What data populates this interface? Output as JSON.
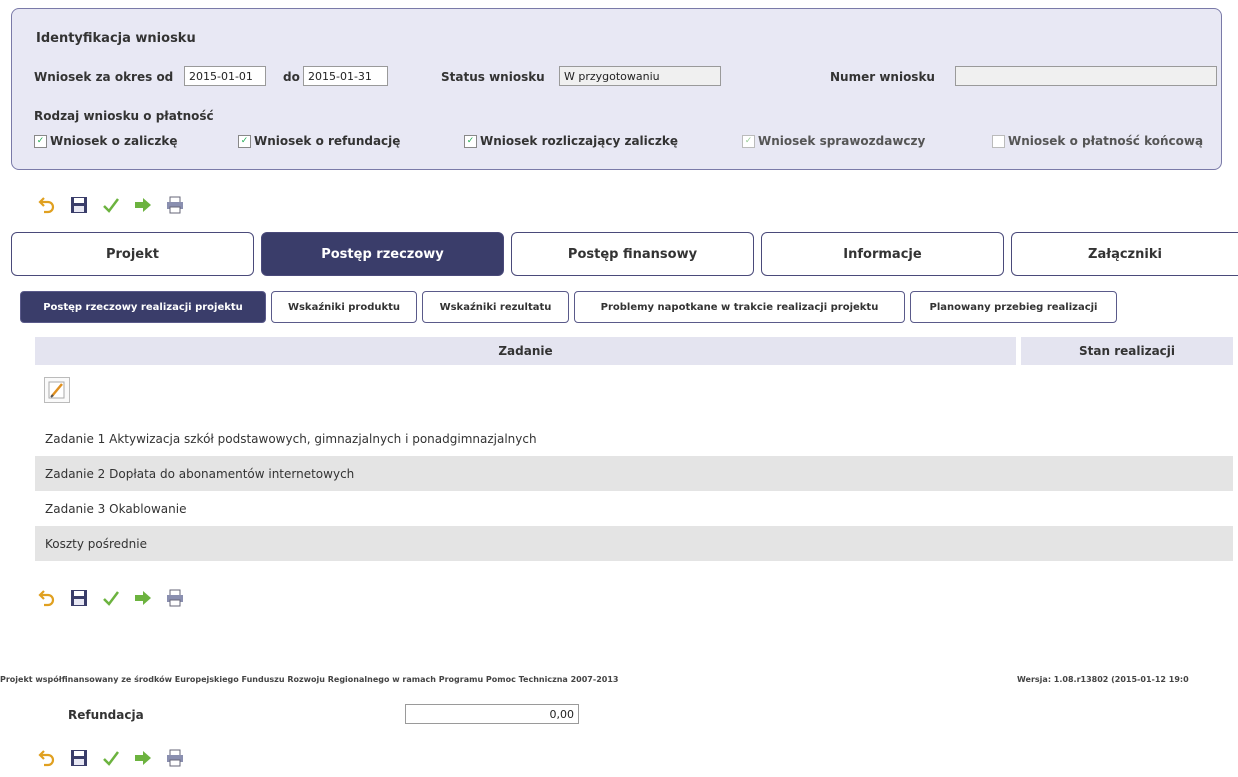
{
  "ident": {
    "title": "Identyfikacja wniosku",
    "period_label": "Wniosek za okres od",
    "date_from": "2015-01-01",
    "to_label": "do",
    "date_to": "2015-01-31",
    "status_label": "Status wniosku",
    "status_value": "W przygotowaniu",
    "number_label": "Numer wniosku",
    "number_value": "",
    "kind_label": "Rodzaj wniosku o płatność",
    "kinds": [
      {
        "label": "Wniosek o zaliczkę",
        "checked": true,
        "disabled": false
      },
      {
        "label": "Wniosek o refundację",
        "checked": true,
        "disabled": false
      },
      {
        "label": "Wniosek rozliczający zaliczkę",
        "checked": true,
        "disabled": false
      },
      {
        "label": "Wniosek sprawozdawczy",
        "checked": true,
        "disabled": true
      },
      {
        "label": "Wniosek o płatność końcową",
        "checked": false,
        "disabled": true
      }
    ]
  },
  "toolbar_icons": [
    "undo-icon",
    "save-icon",
    "check-icon",
    "forward-arrow-icon",
    "print-icon"
  ],
  "main_tabs": [
    "Projekt",
    "Postęp rzeczowy",
    "Postęp finansowy",
    "Informacje",
    "Załączniki"
  ],
  "sub_tabs": [
    "Postęp rzeczowy realizacji projektu",
    "Wskaźniki produktu",
    "Wskaźniki rezultatu",
    "Problemy napotkane w trakcie realizacji projektu",
    "Planowany przebieg realizacji"
  ],
  "table": {
    "headers": [
      "Zadanie",
      "Stan realizacji"
    ],
    "rows": [
      "Zadanie 1 Aktywizacja szkół podstawowych, gimnazjalnych i ponadgimnazjalnych",
      "Zadanie 2 Dopłata do abonamentów internetowych",
      "Zadanie 3 Okablowanie",
      "Koszty pośrednie"
    ]
  },
  "footer": {
    "cofinance": "Projekt współfinansowany ze środków Europejskiego Funduszu Rozwoju Regionalnego w ramach Programu Pomoc Techniczna 2007-2013",
    "version": "Wersja: 1.08.r13802 (2015-01-12 19:0"
  },
  "refund": {
    "label": "Refundacja",
    "value": "0,00"
  },
  "colors": {
    "active_tab": "#3a3d6a",
    "panel_bg": "#e8e8f4",
    "header_bg": "#e4e4f0"
  }
}
